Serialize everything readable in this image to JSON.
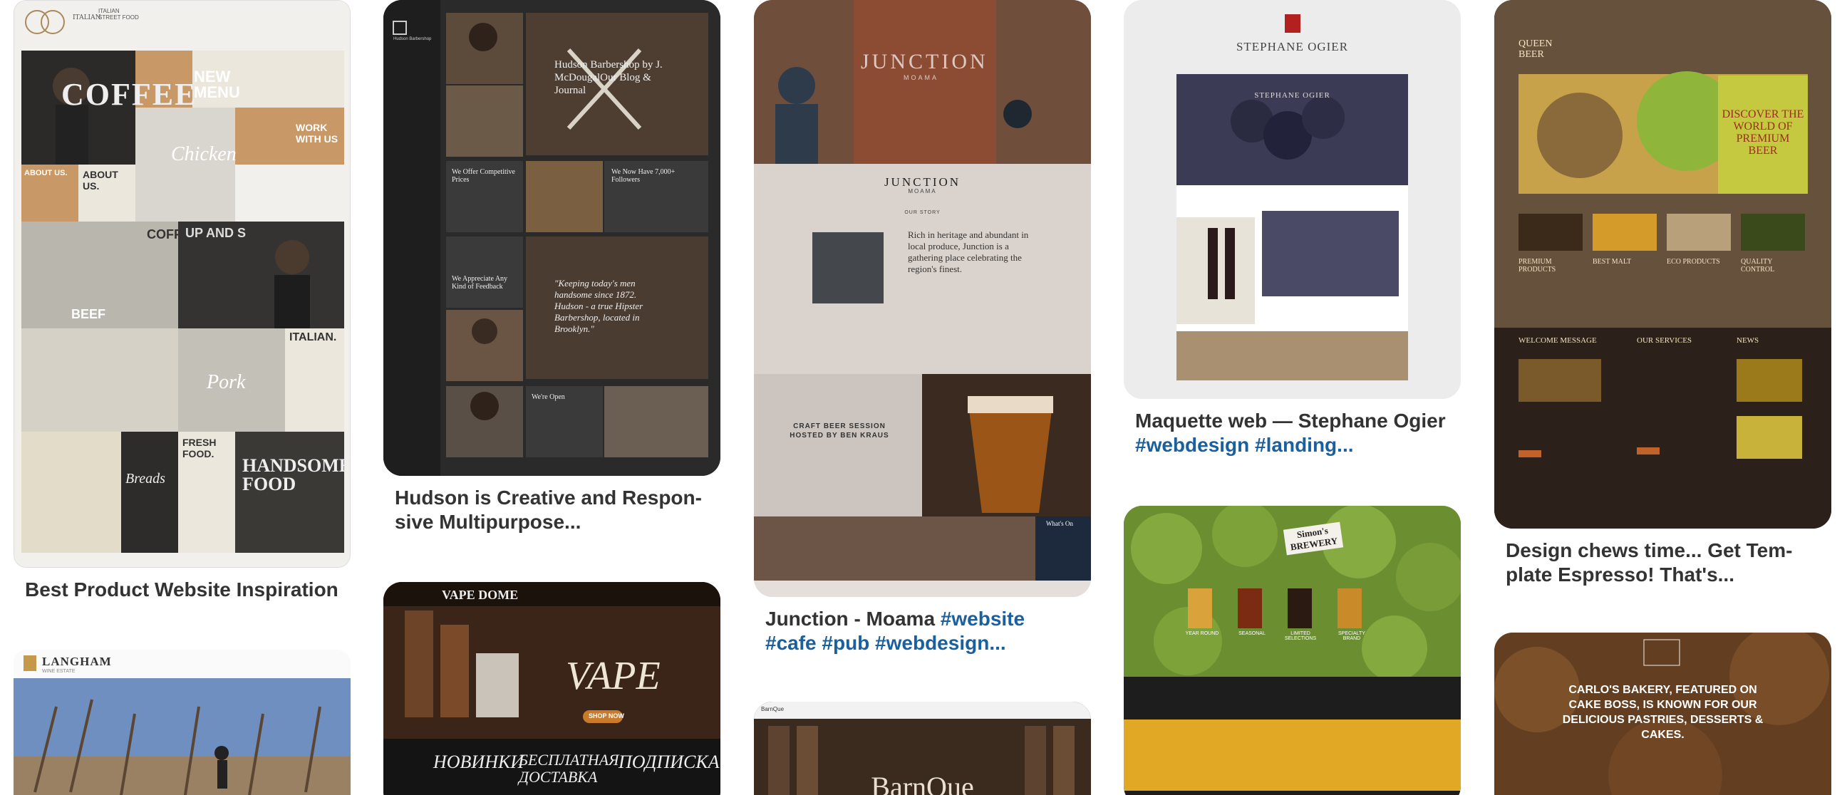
{
  "pins": [
    {
      "id": "p1",
      "title": "Best Product Website Inspiration",
      "hashtags": "",
      "labels": {
        "brand": "ITALIAN STREET FOOD",
        "hero": "COFFEE",
        "menu": "NEW MENU",
        "work": "WORK WITH US",
        "about": "ABOUT US.",
        "coffee": "COFFEE.",
        "chicken": "Chicken",
        "beef": "BEEF",
        "pork": "Pork",
        "italian": "ITALIAN.",
        "fresh": "FRESH FOOD.",
        "breads": "Breads",
        "handsome": "HANDSOME FOOD",
        "upand": "UP AND S"
      }
    },
    {
      "id": "p2",
      "title": "Hudson is Creative and Respon-sive Multipurpose...",
      "hashtags": "",
      "labels": {
        "brand": "Hudson Barbershop",
        "headline": "Hudson Barbershop by J. McDougalOur Blog & Journal",
        "prices": "We Offer Competitive Prices",
        "followers": "We Now Have 7,000+ Followers",
        "feedback": "We Appreciate Any Kind of Feedback",
        "quote": "\"Keeping today's men handsome since 1872. Hudson - a true Hipster Barbershop, located in Brooklyn.\"",
        "open": "We're Open"
      }
    },
    {
      "id": "p3",
      "title": "Junction - Moama ",
      "hashtags": "#website #cafe #pub #webdesign...",
      "labels": {
        "hero": "JUNCTION",
        "sub": "MOAMA",
        "heading": "JUNCTION",
        "heading_sub": "MOAMA",
        "story": "OUR STORY",
        "intro": "Rich in heritage and abundant in local produce, Junction is a gathering place celebrating the region's finest.",
        "craft": "CRAFT BEER SESSION HOSTED BY BEN KRAUS",
        "whats_on": "What's On"
      }
    },
    {
      "id": "p4",
      "title": "Maquette web — Stephane Ogier ",
      "hashtags": "#webdesign #landing...",
      "labels": {
        "brand": "STEPHANE OGIER",
        "inner_brand": "STEPHANE OGIER"
      }
    },
    {
      "id": "p5",
      "title": "Design chews time... Get Tem-plate Espresso! That's...",
      "hashtags": "",
      "labels": {
        "brand": "QUEEN BEER",
        "hero": "DISCOVER THE WORLD OF PREMIUM BEER",
        "c1": "PREMIUM PRODUCTS",
        "c2": "BEST MALT",
        "c3": "ECO PRODUCTS",
        "c4": "QUALITY CONTROL",
        "welcome": "WELCOME MESSAGE",
        "services": "OUR SERVICES",
        "news": "NEWS"
      }
    },
    {
      "id": "p6",
      "title": "",
      "hashtags": "",
      "labels": {
        "brand": "LANGHAM",
        "sub": "WINE ESTATE"
      }
    },
    {
      "id": "p7",
      "title": "",
      "hashtags": "",
      "labels": {
        "brand": "VAPE DOME",
        "hero": "VAPE",
        "shop": "SHOP NOW",
        "c1": "НОВИНКИ",
        "c2": "БЕСПЛАТНАЯ ДОСТАВКА",
        "c3": "ПОДПИСКА"
      }
    },
    {
      "id": "p8",
      "title": "",
      "hashtags": "",
      "labels": {
        "brand": "BarnQue",
        "hero": "BarnQue"
      }
    },
    {
      "id": "p9",
      "title": "",
      "hashtags": "",
      "labels": {
        "brand": "Simon's BREWERY",
        "b1": "YEAR ROUND",
        "b2": "SEASONAL",
        "b3": "LIMITED SELECTIONS",
        "b4": "SPECIALTY BRAND"
      }
    },
    {
      "id": "p10",
      "title": "",
      "hashtags": "",
      "labels": {
        "hero": "CARLO'S BAKERY, FEATURED ON CAKE BOSS, IS KNOWN FOR OUR DELICIOUS PASTRIES, DESSERTS & CAKES."
      }
    }
  ],
  "colors": {
    "title": "#333333",
    "hashtag": "#1a5f9e",
    "background": "#ffffff"
  }
}
